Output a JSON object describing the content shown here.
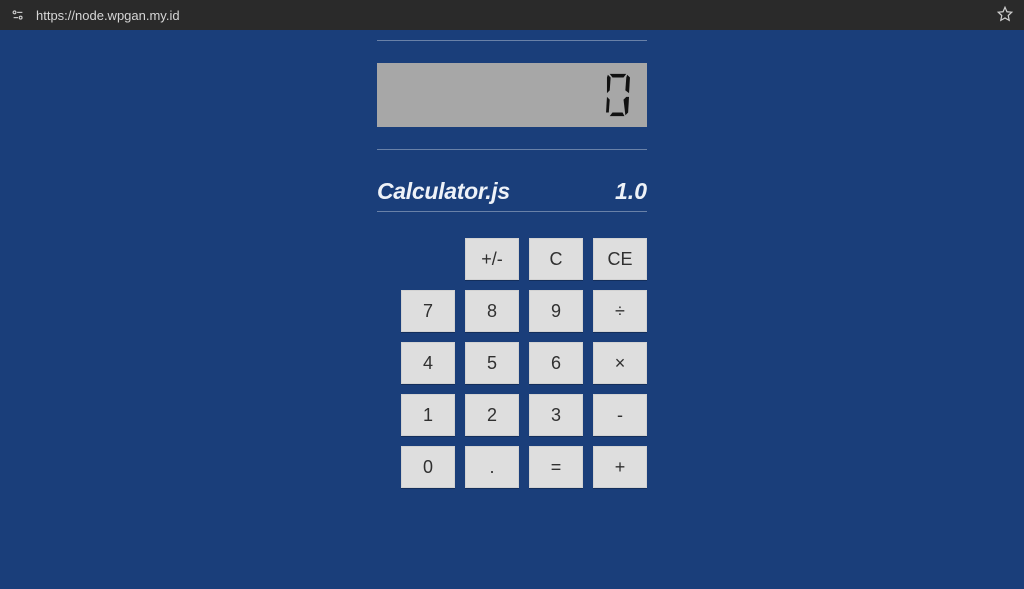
{
  "browser": {
    "url": "https://node.wpgan.my.id"
  },
  "calculator": {
    "display_value": "0",
    "title": "Calculator.js",
    "version": "1.0",
    "keys": {
      "plusminus": "+/-",
      "clear": "C",
      "clear_entry": "CE",
      "n7": "7",
      "n8": "8",
      "n9": "9",
      "divide": "÷",
      "n4": "4",
      "n5": "5",
      "n6": "6",
      "multiply": "×",
      "n1": "1",
      "n2": "2",
      "n3": "3",
      "subtract": "-",
      "n0": "0",
      "decimal": ".",
      "equals": "=",
      "add": "+"
    }
  }
}
